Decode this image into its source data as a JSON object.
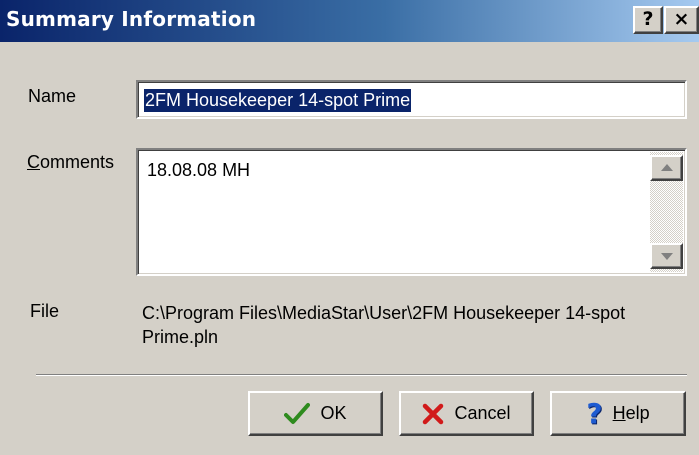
{
  "window": {
    "title": "Summary Information",
    "help_caption": "?",
    "close_caption": "×"
  },
  "form": {
    "name_label": "Name",
    "name_value": "2FM Housekeeper 14-spot Prime",
    "comments_label_mnemonic": "C",
    "comments_label_rest": "omments",
    "comments_value": "18.08.08 MH",
    "file_label": "File",
    "file_path": "C:\\Program Files\\MediaStar\\User\\2FM Housekeeper 14-spot Prime.pln"
  },
  "buttons": {
    "ok_label": "OK",
    "cancel_label": "Cancel",
    "help_mnemonic": "H",
    "help_rest": "elp"
  },
  "icons": {
    "ok": "checkmark-icon",
    "cancel": "red-x-icon",
    "help": "question-mark-icon",
    "scroll_up": "arrow-up-icon",
    "scroll_down": "arrow-down-icon"
  },
  "colors": {
    "title_start": "#0a246a",
    "title_end": "#a6caf0",
    "face": "#d4d0c8",
    "selection": "#0a246a",
    "ok_green": "#2e8b1e",
    "cancel_red": "#d11a1a",
    "help_blue": "#1e5bd1"
  }
}
